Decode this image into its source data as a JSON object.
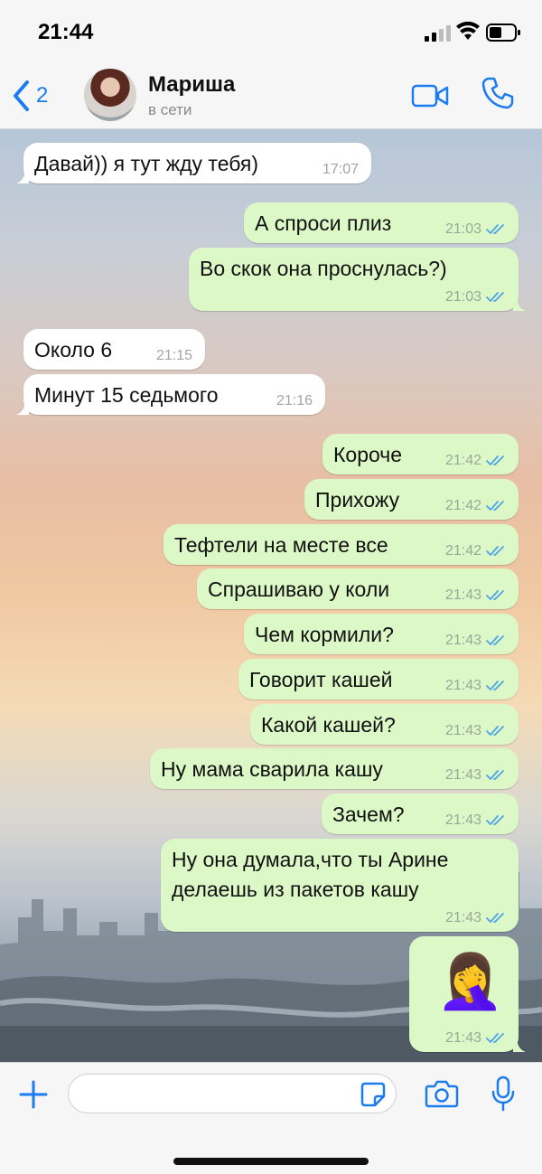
{
  "status": {
    "time": "21:44"
  },
  "header": {
    "back_count": "2",
    "contact_name": "Мариша",
    "contact_status": "в сети"
  },
  "messages": [
    {
      "dir": "in",
      "text": "Давай)) я тут жду тебя)",
      "time": "17:07"
    },
    {
      "dir": "out",
      "text": "А спроси плиз",
      "time": "21:03"
    },
    {
      "dir": "out",
      "text": "Во скок она проснулась?)",
      "time": "21:03"
    },
    {
      "dir": "in",
      "text": "Около 6",
      "time": "21:15"
    },
    {
      "dir": "in",
      "text": "Минут 15 седьмого",
      "time": "21:16"
    },
    {
      "dir": "out",
      "text": "Короче",
      "time": "21:42"
    },
    {
      "dir": "out",
      "text": "Прихожу",
      "time": "21:42"
    },
    {
      "dir": "out",
      "text": "Тефтели на месте все",
      "time": "21:42"
    },
    {
      "dir": "out",
      "text": "Спрашиваю у коли",
      "time": "21:43"
    },
    {
      "dir": "out",
      "text": "Чем кормили?",
      "time": "21:43"
    },
    {
      "dir": "out",
      "text": "Говорит кашей",
      "time": "21:43"
    },
    {
      "dir": "out",
      "text": "Какой кашей?",
      "time": "21:43"
    },
    {
      "dir": "out",
      "text": "Ну мама сварила кашу",
      "time": "21:43"
    },
    {
      "dir": "out",
      "text": "Зачем?",
      "time": "21:43"
    },
    {
      "dir": "out",
      "text": "Ну она думала,что ты Арине",
      "text2": "делаешь из пакетов кашу",
      "time": "21:43"
    },
    {
      "dir": "out",
      "emoji": "🤦‍♀️",
      "time": "21:43"
    }
  ],
  "input": {
    "placeholder": ""
  },
  "colors": {
    "accent": "#1b7cf0",
    "outgoing": "#dcf8c6",
    "incoming": "#ffffff",
    "read_ticks": "#4fa3e8"
  }
}
